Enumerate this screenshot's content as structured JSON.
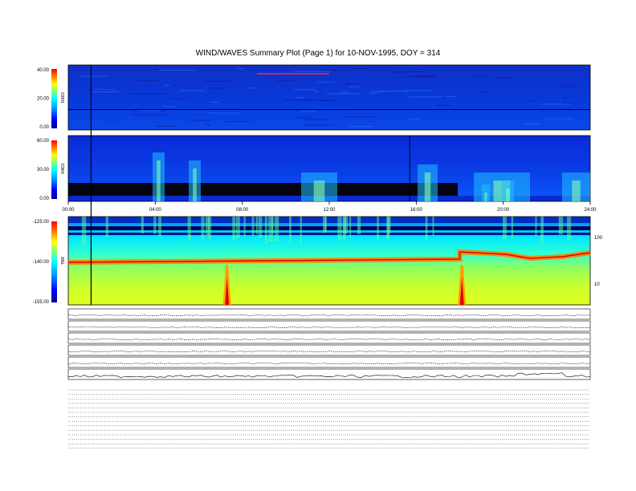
{
  "page": {
    "title": "WIND/WAVES Summary Plot (Page 1) for 10-NOV-1995, DOY = 314"
  },
  "chart_data": {
    "type": "heatmap",
    "title": "WIND/WAVES Summary Plot (Page 1) for 10-NOV-1995, DOY = 314",
    "xlabel": "",
    "ylabel": "",
    "xlim": [
      0,
      24
    ],
    "x_tick_labels": [
      "00:00",
      "04:00",
      "08:00",
      "12:00",
      "16:00",
      "20:00",
      "24:00"
    ],
    "colormap": [
      "#00008f",
      "#0000ff",
      "#00a0ff",
      "#00ffff",
      "#80ff80",
      "#ffff00",
      "#ff8000",
      "#ff0000",
      "#800000"
    ],
    "panels": [
      {
        "name": "RAD2",
        "y_tick_labels": [
          "40.00",
          "20.00",
          "0.00"
        ],
        "color_range": [
          0,
          40
        ]
      },
      {
        "name": "RAD1",
        "y_tick_labels": [
          "60.00",
          "30.00",
          "0.00"
        ],
        "color_range": [
          0,
          60
        ]
      },
      {
        "name": "TNR",
        "y_tick_labels": [
          "-125.00",
          "-140.00",
          "-155.00"
        ],
        "color_range": [
          -155,
          -125
        ],
        "right_tick_labels": [
          "100",
          "10"
        ]
      }
    ],
    "features": [
      {
        "panel": "all",
        "type": "vertical-line",
        "x": 1.05
      },
      {
        "panel": "RAD1",
        "type": "vertical-line",
        "x": 15.7
      },
      {
        "panel": "TNR",
        "type": "burst",
        "x": 7.3
      },
      {
        "panel": "TNR",
        "type": "burst",
        "x": 18.1
      },
      {
        "panel": "TNR",
        "type": "plasma-line-step",
        "x": 18.0
      }
    ]
  }
}
